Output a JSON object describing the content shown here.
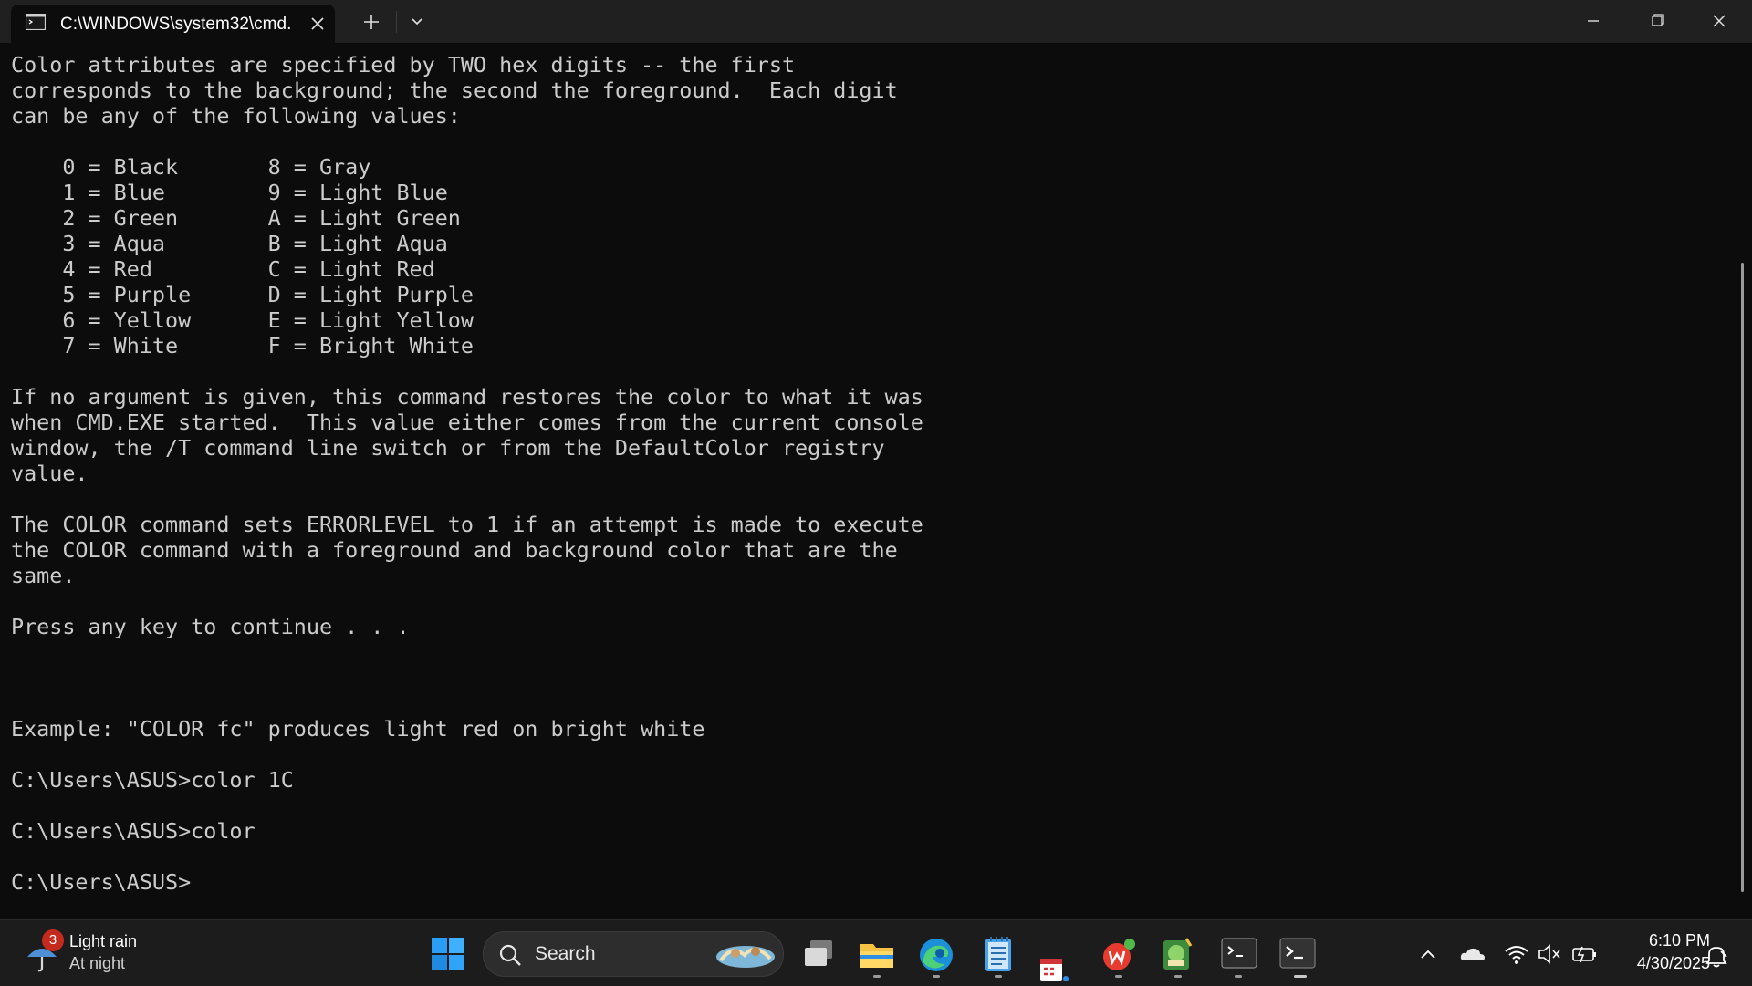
{
  "window": {
    "tab_title": "C:\\WINDOWS\\system32\\cmd.",
    "background": "#0c0c0c",
    "text_color": "#cccccc"
  },
  "console": {
    "lines": [
      "Color attributes are specified by TWO hex digits -- the first",
      "corresponds to the background; the second the foreground.  Each digit",
      "can be any of the following values:",
      "",
      "    0 = Black       8 = Gray",
      "    1 = Blue        9 = Light Blue",
      "    2 = Green       A = Light Green",
      "    3 = Aqua        B = Light Aqua",
      "    4 = Red         C = Light Red",
      "    5 = Purple      D = Light Purple",
      "    6 = Yellow      E = Light Yellow",
      "    7 = White       F = Bright White",
      "",
      "If no argument is given, this command restores the color to what it was",
      "when CMD.EXE started.  This value either comes from the current console",
      "window, the /T command line switch or from the DefaultColor registry",
      "value.",
      "",
      "The COLOR command sets ERRORLEVEL to 1 if an attempt is made to execute",
      "the COLOR command with a foreground and background color that are the",
      "same.",
      "",
      "Press any key to continue . . .",
      "",
      "",
      "",
      "Example: \"COLOR fc\" produces light red on bright white",
      "",
      "C:\\Users\\ASUS>color 1C",
      "",
      "C:\\Users\\ASUS>color",
      "",
      "C:\\Users\\ASUS>"
    ]
  },
  "taskbar": {
    "weather_badge": "3",
    "weather_title": "Light rain",
    "weather_subtitle": "At night",
    "search_label": "Search",
    "time": "6:10 PM",
    "date": "4/30/2025",
    "icons": [
      "start-icon",
      "task-view-icon",
      "file-explorer-icon",
      "edge-icon",
      "notepad-icon",
      "calendar-icon",
      "wps-office-icon",
      "game-app-icon",
      "terminal-icon",
      "terminal-icon-2",
      "chevron-up-icon",
      "onedrive-icon",
      "wifi-icon",
      "volume-muted-icon",
      "battery-icon",
      "notification-icon"
    ]
  }
}
